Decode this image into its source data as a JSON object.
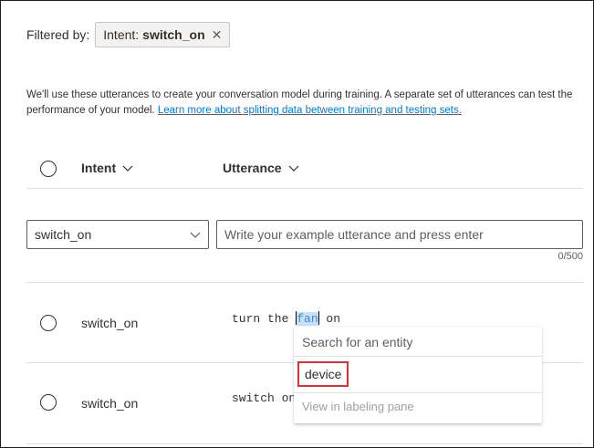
{
  "filter": {
    "label": "Filtered by:",
    "chip_key": "Intent:",
    "chip_value": "switch_on",
    "close_glyph": "✕"
  },
  "description": {
    "text": "We'll use these utterances to create your conversation model during training. A separate set of utterances can test the performance of your model. ",
    "link": "Learn more about splitting data between training and testing sets."
  },
  "table": {
    "col_intent": "Intent",
    "col_utterance": "Utterance"
  },
  "new_utterance": {
    "intent_value": "switch_on",
    "placeholder": "Write your example utterance and press enter",
    "counter": "0/500"
  },
  "rows": [
    {
      "intent": "switch_on",
      "utterance_pre": "turn the ",
      "utterance_sel": "fan",
      "utterance_post": " on"
    },
    {
      "intent": "switch_on",
      "utterance": "switch on"
    }
  ],
  "entity_popup": {
    "search_placeholder": "Search for an entity",
    "option": "device",
    "footer_link": "View in labeling pane"
  },
  "colors": {
    "accent": "#0078d4",
    "highlight_border": "#e03030",
    "selection": "#c7e0f4"
  },
  "icons": [
    "close-icon",
    "chevron-down-icon"
  ]
}
